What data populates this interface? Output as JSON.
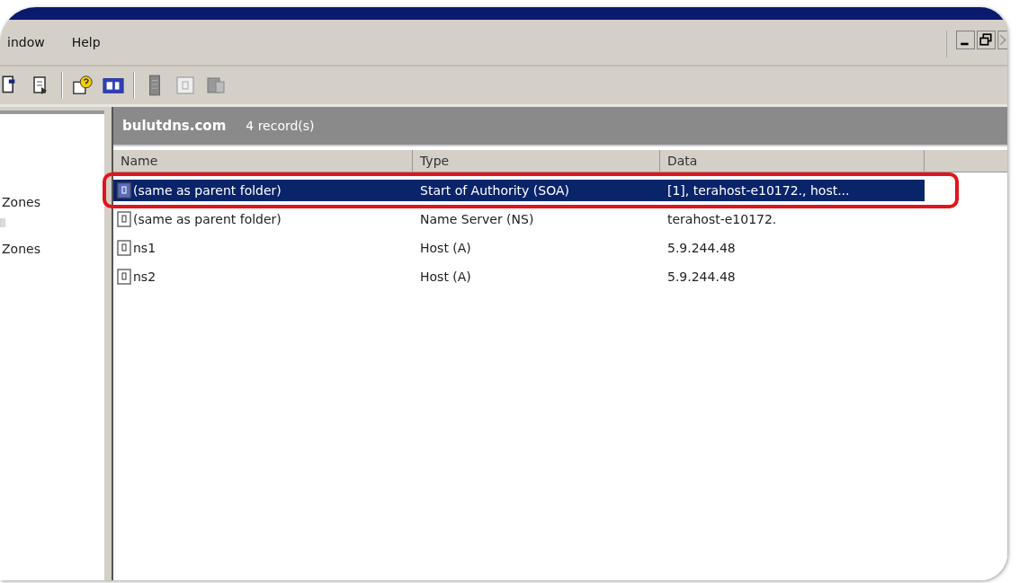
{
  "menu": [
    {
      "label": "indow"
    },
    {
      "label": "Help"
    }
  ],
  "tree": [
    {
      "label": "Zones"
    },
    {
      "label": "Zones"
    }
  ],
  "details": {
    "title": "bulutdns.com",
    "count": "4 record(s)"
  },
  "table": {
    "columns": [
      "Name",
      "Type",
      "Data"
    ],
    "rows": [
      {
        "name": "(same as parent folder)",
        "type": "Start of Authority (SOA)",
        "data": "[1], terahost-e10172., host...",
        "selected": true
      },
      {
        "name": "(same as parent folder)",
        "type": "Name Server (NS)",
        "data": "terahost-e10172.",
        "selected": false
      },
      {
        "name": "ns1",
        "type": "Host (A)",
        "data": "5.9.244.48",
        "selected": false
      },
      {
        "name": "ns2",
        "type": "Host (A)",
        "data": "5.9.244.48",
        "selected": false
      }
    ]
  }
}
